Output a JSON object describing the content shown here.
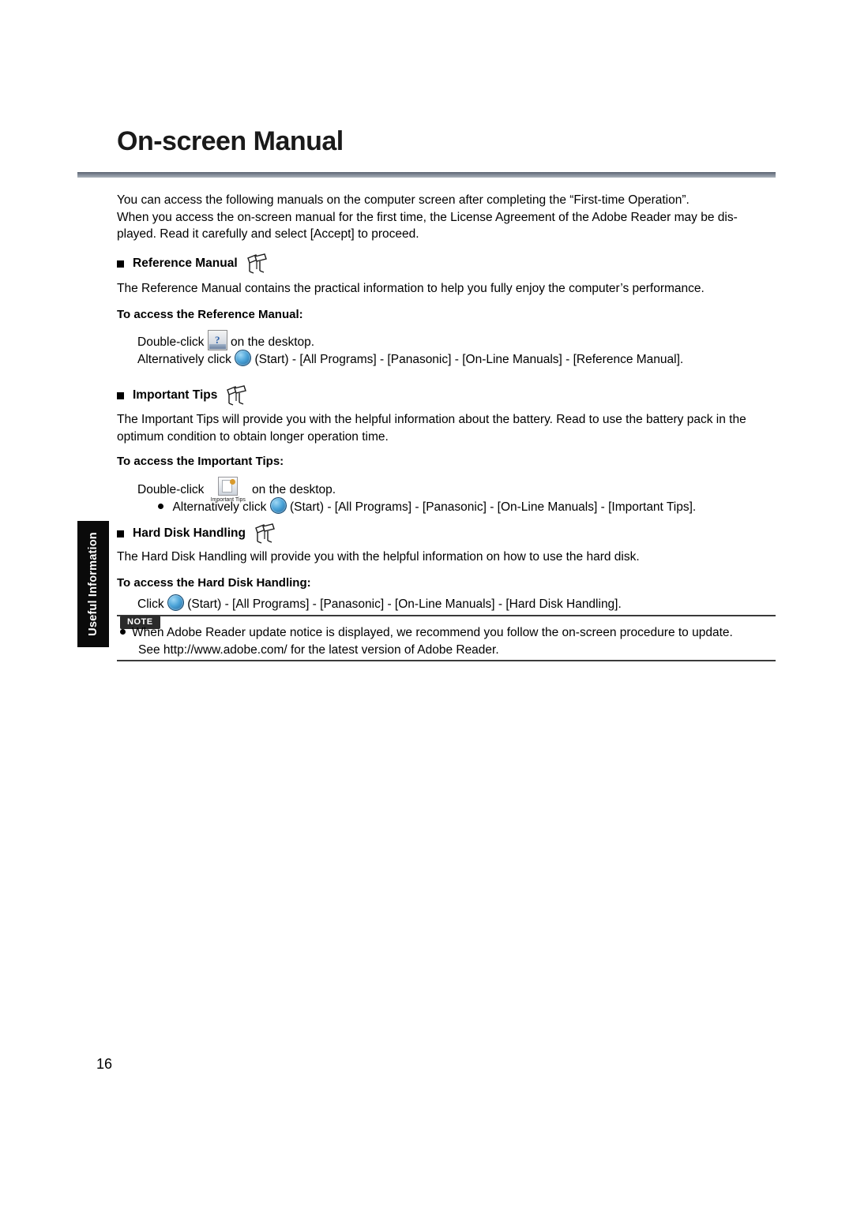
{
  "page": {
    "title": "On-screen Manual",
    "number": "16",
    "side_tab": "Useful Information"
  },
  "intro": {
    "line1": "You can access the following manuals on the computer screen after completing the “First-time Operation”.",
    "line2": "When you access the on-screen manual for the first time, the License Agreement of the Adobe Reader may be dis-",
    "line3": "played. Read it carefully and select [Accept] to proceed."
  },
  "sections": [
    {
      "heading": "Reference Manual",
      "icon": "book-manual-icon",
      "body": "The Reference Manual contains the practical information to help you fully enjoy the computer’s performance.",
      "access_heading": "To access the Reference Manual:",
      "step1_pre": "Double-click",
      "step1_icon": "reference-manual-desktop-icon",
      "step1_post": "on the desktop.",
      "step2_pre": "Alternatively click",
      "step2_icon": "start-button-icon",
      "step2_post": "(Start) - [All Programs] - [Panasonic] - [On-Line Manuals] - [Reference Manual]."
    },
    {
      "heading": "Important Tips",
      "icon": "book-manual-icon",
      "body_line1": "The Important Tips will provide you with the helpful information about the battery. Read to use the battery pack in the",
      "body_line2": "optimum condition to obtain longer operation time.",
      "access_heading": "To access the Important Tips:",
      "step1_pre": "Double-click",
      "step1_icon": "important-tips-desktop-icon",
      "step1_icon_caption": "Important Tips",
      "step1_post": "on the desktop.",
      "step2_pre": "Alternatively click",
      "step2_icon": "start-button-icon",
      "step2_post": "(Start) - [All Programs] - [Panasonic] - [On-Line Manuals] - [Important Tips]."
    },
    {
      "heading": "Hard Disk Handling",
      "icon": "book-manual-icon",
      "body": "The Hard Disk Handling will provide you with the helpful information on how to use the hard disk.",
      "access_heading": "To access the Hard Disk Handling:",
      "step1_pre": "Click",
      "step1_icon": "start-button-icon",
      "step1_post": "(Start) - [All Programs] - [Panasonic] - [On-Line Manuals] - [Hard Disk Handling]."
    }
  ],
  "note": {
    "label": "NOTE",
    "line1": "When Adobe Reader update notice is displayed, we recommend you follow the on-screen procedure to update.",
    "line2": "See http://www.adobe.com/ for the latest version of Adobe Reader."
  },
  "colors": {
    "rule": "#7f8894",
    "sidetab_bg": "#0a0a0a",
    "note_rule": "#3a3a3a"
  }
}
